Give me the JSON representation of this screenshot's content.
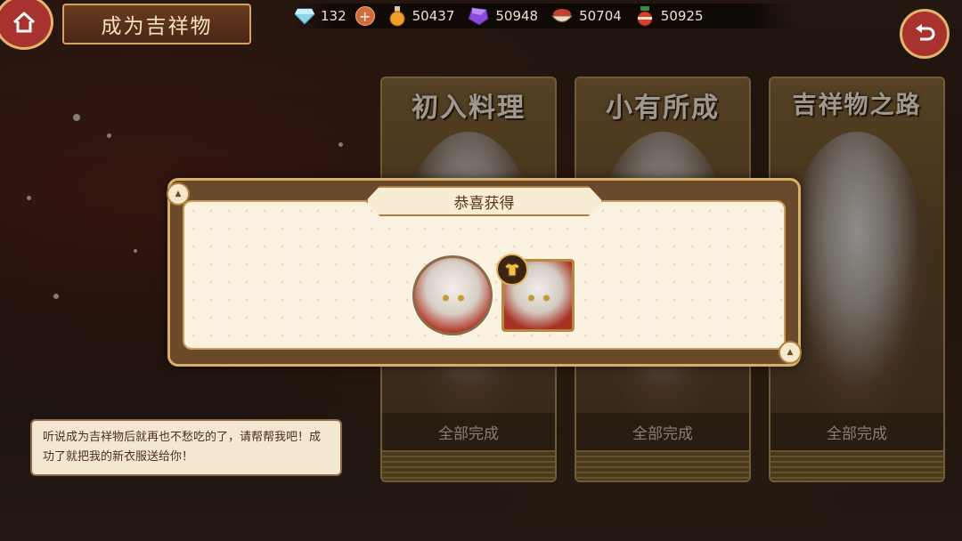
{
  "header": {
    "title": "成为吉祥物",
    "home_icon": "house-icon",
    "back_icon": "return-arrow-icon"
  },
  "resources": [
    {
      "icon": "diamond-icon",
      "value": "132",
      "has_plus": true
    },
    {
      "icon": "potion-icon",
      "value": "50437"
    },
    {
      "icon": "purple-gem-icon",
      "value": "50948"
    },
    {
      "icon": "food-bowl-icon",
      "value": "50704"
    },
    {
      "icon": "jar-icon",
      "value": "50925"
    }
  ],
  "stages": [
    {
      "name": "初入料理",
      "status": "全部完成"
    },
    {
      "name": "小有所成",
      "status": "全部完成"
    },
    {
      "name": "吉祥物之路",
      "status": "全部完成"
    }
  ],
  "dialog": {
    "text": "听说成为吉祥物后就再也不愁吃的了，请帮帮我吧！成功了就把我的新衣服送给你！"
  },
  "popup": {
    "title": "恭喜获得",
    "rewards": [
      {
        "type": "avatar",
        "icon": "character-avatar-icon"
      },
      {
        "type": "costume",
        "icon": "costume-portrait-icon",
        "badge_icon": "shirt-icon"
      }
    ]
  },
  "colors": {
    "accent_red": "#a8322e",
    "gold_border": "#d8b068",
    "popup_bg": "#fbf2e2"
  }
}
